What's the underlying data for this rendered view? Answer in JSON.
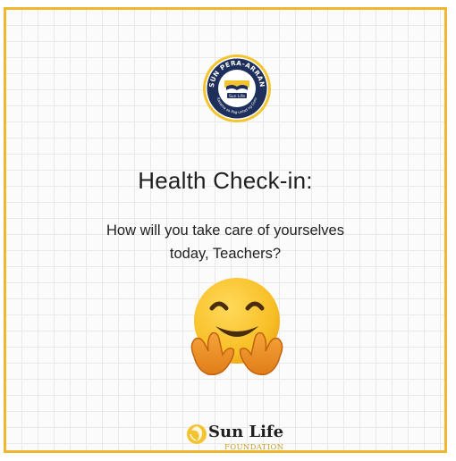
{
  "heading": "Health Check-in:",
  "question_line1": "How will you take care of yourselves",
  "question_line2": "today, Teachers?",
  "seal": {
    "ring_text": "SUN PERA-ARRAN",
    "lower_text": "Kasama sa Pag-unlad ng Guro",
    "center_text": "Sun Life",
    "icon": "open-book-seal-icon"
  },
  "emoji": {
    "icon": "hugging-face-emoji"
  },
  "brand": {
    "name": "Sun Life",
    "sub": "FOUNDATION",
    "icon": "sun-swirl-icon"
  },
  "colors": {
    "accent": "#f1b62f",
    "seal_navy": "#1d2f5a",
    "text": "#1f1f1f"
  }
}
